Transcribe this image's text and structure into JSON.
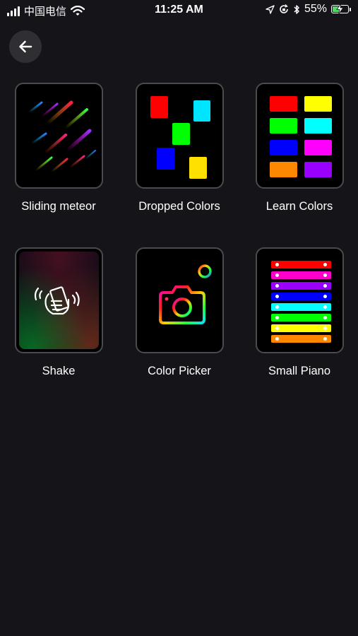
{
  "status_bar": {
    "carrier": "中国电信",
    "time": "11:25 AM",
    "battery": "55%",
    "battery_level": 0.55,
    "icons": [
      "signal-bars-icon",
      "wifi-icon",
      "location-icon",
      "orientation-lock-icon",
      "bluetooth-icon",
      "battery-icon",
      "charging-bolt-icon"
    ]
  },
  "nav": {
    "back_icon": "arrow-left-icon"
  },
  "games": [
    {
      "label": "Sliding meteor"
    },
    {
      "label": "Dropped Colors"
    },
    {
      "label": "Learn Colors"
    },
    {
      "label": "Shake"
    },
    {
      "label": "Color Picker"
    },
    {
      "label": "Small Piano"
    }
  ],
  "palette": {
    "background": "#151519",
    "tile_border": "#4a4a4f",
    "dropped_colors": [
      "#ff0000",
      "#00e5ff",
      "#00ff00",
      "#0000ff",
      "#ffe000"
    ],
    "learn_colors": [
      "#ff0000",
      "#ffff00",
      "#00ff00",
      "#00ffff",
      "#0000ff",
      "#ff00ff",
      "#ff8800",
      "#9900ff"
    ],
    "piano_keys": [
      "#ff0000",
      "#ff00cc",
      "#9900ff",
      "#0000ff",
      "#00ffff",
      "#00ff00",
      "#ffff00",
      "#ff8800"
    ]
  }
}
